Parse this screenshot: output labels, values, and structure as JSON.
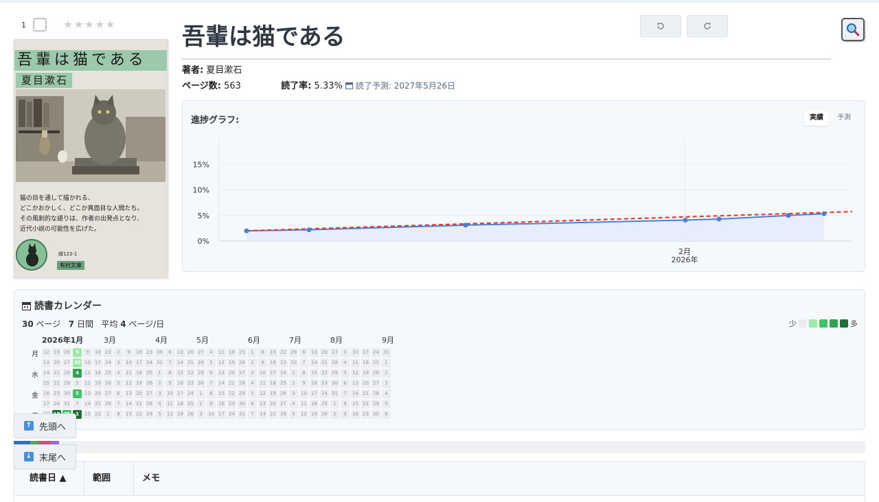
{
  "book": {
    "index": "1",
    "rating_stars": "★★★★★",
    "title": "吾輩は猫である",
    "author_label": "著者:",
    "author": "夏目漱石",
    "pages_label": "ページ数:",
    "pages": "563",
    "progress_label": "読了率:",
    "progress": "5.33%",
    "predict_label": "読了予測:",
    "predict_date": "2027年5月26日"
  },
  "cover": {
    "title": "吾輩は猫である",
    "author": "夏目漱石",
    "blurb": "猫の目を通して描かれる、\nどこかおかしく、どこか真面目な人間たち。\nその風刺的な語りは、作者の出発点となり、\n近代小説の可能性を広げた。",
    "code": "緑123-1",
    "publisher": "有村文庫"
  },
  "toolbar": {
    "undo_icon": "undo-icon",
    "redo_icon": "redo-icon",
    "search_icon": "search-icon"
  },
  "progress_chart": {
    "title": "進捗グラフ:",
    "toggle_actual": "実績",
    "toggle_predict": "予測"
  },
  "chart_data": {
    "type": "line",
    "title": "進捗グラフ:",
    "x_ticks": [
      "2月",
      "2026年"
    ],
    "y_ticks": [
      "0%",
      "5%",
      "10%",
      "15%"
    ],
    "ylim": [
      0,
      20
    ],
    "series": [
      {
        "values": [
          2.0,
          2.2,
          3.1,
          4.1,
          4.3,
          5.0,
          5.33
        ]
      }
    ],
    "colors": {
      "actual": "#4a7fd6",
      "trend": "#e53935",
      "fill": "#e3ecfa"
    }
  },
  "calendar": {
    "title": "読書カレンダー",
    "stats_pages": "30",
    "stats_pages_unit": "ページ",
    "stats_days": "7",
    "stats_days_unit": "日間",
    "stats_avg_label": "平均",
    "stats_avg": "4",
    "stats_avg_unit": "ページ/日",
    "legend_low": "少",
    "legend_high": "多",
    "legend_colors": [
      "#ebedf0",
      "#9be9a8",
      "#40c463",
      "#30a14e",
      "#216e39"
    ],
    "months": [
      "2026年1月",
      "3月",
      "4月",
      "5月",
      "6月",
      "7月",
      "8月",
      "9月"
    ],
    "weekdays": [
      "月",
      "水",
      "金",
      "日"
    ],
    "active_cells": [
      {
        "col": 3,
        "row": 0,
        "label": "5",
        "level": 1
      },
      {
        "col": 3,
        "row": 1,
        "label": "20",
        "level": 1
      },
      {
        "col": 3,
        "row": 2,
        "label": "4",
        "level": 3
      },
      {
        "col": 3,
        "row": 4,
        "label": "5",
        "level": 2
      },
      {
        "col": 1,
        "row": 6,
        "label": "18",
        "level": 4
      },
      {
        "col": 2,
        "row": 6,
        "label": "25",
        "level": 2
      },
      {
        "col": 3,
        "row": 6,
        "label": "1",
        "level": 4
      }
    ]
  },
  "nav": {
    "top_label": "先頭へ",
    "bottom_label": "末尾へ"
  },
  "table": {
    "columns": [
      "読書日 ▲",
      "範囲",
      "メモ"
    ]
  }
}
